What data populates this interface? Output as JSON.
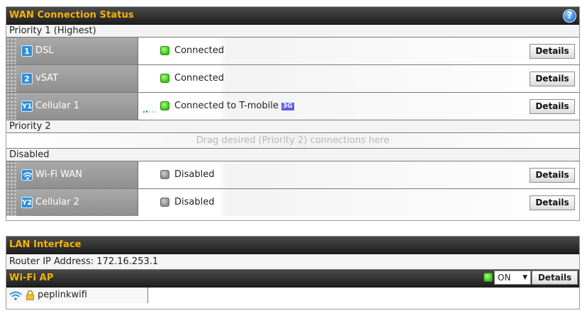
{
  "wan": {
    "title": "WAN Connection Status",
    "help": "?",
    "priority1": {
      "label": "Priority 1 (Highest)",
      "items": [
        {
          "badge": "1",
          "name": "DSL",
          "status": "Connected",
          "details": "Details"
        },
        {
          "badge": "2",
          "name": "vSAT",
          "status": "Connected",
          "details": "Details"
        },
        {
          "badge": "Y1",
          "name": "Cellular 1",
          "status": "Connected to T-mobile",
          "tag": "3G",
          "details": "Details"
        }
      ]
    },
    "priority2": {
      "label": "Priority 2",
      "placeholder": "Drag desired (Priority 2) connections here"
    },
    "disabled": {
      "label": "Disabled",
      "items": [
        {
          "name": "Wi-Fi WAN",
          "status": "Disabled",
          "details": "Details"
        },
        {
          "badge": "Y2",
          "name": "Cellular 2",
          "status": "Disabled",
          "details": "Details"
        }
      ]
    }
  },
  "lan": {
    "title": "LAN Interface",
    "router_ip": "Router IP Address: 172.16.253.1"
  },
  "wifi_ap": {
    "title": "Wi-Fi AP",
    "select_value": "ON",
    "details": "Details",
    "ssid": "peplinkwifi"
  },
  "colors": {
    "header_title": "#f5b400",
    "status_green": "#3fc31a",
    "status_gray": "#8a8a8a",
    "tag_3g": "#5f5fe6",
    "badge_blue": "#2f8fd8"
  }
}
